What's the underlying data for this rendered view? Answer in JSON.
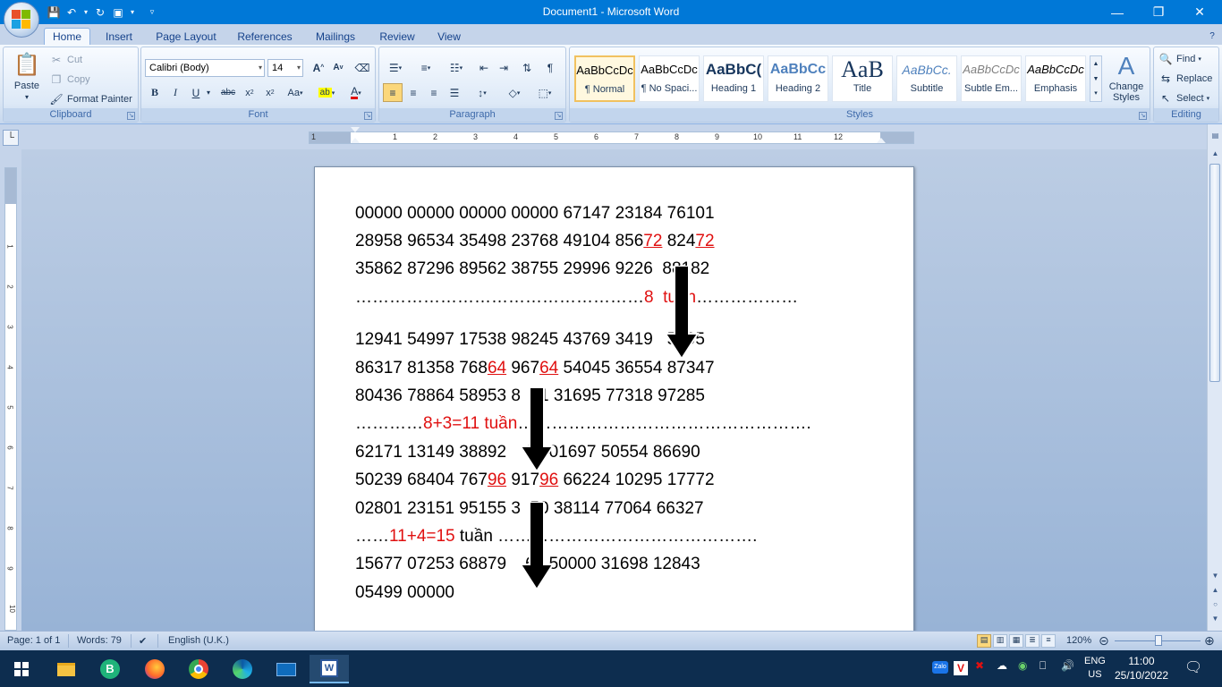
{
  "window": {
    "title": "Document1 - Microsoft Word"
  },
  "tabs": [
    "Home",
    "Insert",
    "Page Layout",
    "References",
    "Mailings",
    "Review",
    "View"
  ],
  "clipboard": {
    "paste": "Paste",
    "cut": "Cut",
    "copy": "Copy",
    "format_painter": "Format Painter",
    "label": "Clipboard"
  },
  "font": {
    "name": "Calibri (Body)",
    "size": "14",
    "label": "Font"
  },
  "paragraph": {
    "label": "Paragraph"
  },
  "styles": {
    "label": "Styles",
    "items": [
      {
        "sample": "AaBbCcDc",
        "name": "¶ Normal"
      },
      {
        "sample": "AaBbCcDc",
        "name": "¶ No Spaci..."
      },
      {
        "sample": "AaBbC(",
        "name": "Heading 1"
      },
      {
        "sample": "AaBbCc",
        "name": "Heading 2"
      },
      {
        "sample": "AaB",
        "name": "Title"
      },
      {
        "sample": "AaBbCc.",
        "name": "Subtitle"
      },
      {
        "sample": "AaBbCcDc",
        "name": "Subtle Em..."
      },
      {
        "sample": "AaBbCcDc",
        "name": "Emphasis"
      }
    ],
    "change_styles": "Change Styles"
  },
  "editing": {
    "find": "Find",
    "replace": "Replace",
    "select": "Select",
    "label": "Editing"
  },
  "ruler": {
    "numbers": [
      "1",
      "1",
      "2",
      "3",
      "4",
      "5",
      "6",
      "7",
      "8",
      "9",
      "10",
      "11",
      "12"
    ]
  },
  "document": {
    "lines": [
      {
        "parts": [
          {
            "t": "00000 00000 00000 00000 67147 23184 76101"
          }
        ]
      },
      {
        "parts": [
          {
            "t": "28958 96534 35498 23768 49104 856"
          },
          {
            "t": "72",
            "s": "redu"
          },
          {
            "t": " 824"
          },
          {
            "t": "72",
            "s": "redu"
          }
        ]
      },
      {
        "parts": [
          {
            "t": "35862 87296 89562 38755 29996 9226  88182"
          }
        ]
      },
      {
        "parts": [
          {
            "t": "……………………………………………"
          },
          {
            "t": "8  tuần",
            "s": "red"
          },
          {
            "t": "………………"
          }
        ]
      },
      {
        "parts": [
          {
            "t": "12941 54997 17538 98245 43769 3419   5295"
          }
        ]
      },
      {
        "parts": [
          {
            "t": "86317 81358 768"
          },
          {
            "t": "64",
            "s": "redu"
          },
          {
            "t": " 967"
          },
          {
            "t": "64",
            "s": "redu"
          },
          {
            "t": " 54045 36554 87347"
          }
        ]
      },
      {
        "parts": [
          {
            "t": "80436 78864 58953 8  91 31695 77318 97285"
          }
        ]
      },
      {
        "parts": [
          {
            "t": "…………"
          },
          {
            "t": "8+3=11 tuần",
            "s": "red"
          },
          {
            "t": "……………………………………………."
          }
        ]
      },
      {
        "parts": [
          {
            "t": "62171 13149 38892    39 01697 50554 86690"
          }
        ]
      },
      {
        "parts": [
          {
            "t": "50239 68404 767"
          },
          {
            "t": "96",
            "s": "redu"
          },
          {
            "t": " 917"
          },
          {
            "t": "96",
            "s": "redu"
          },
          {
            "t": " 66224 10295 17772"
          }
        ]
      },
      {
        "parts": [
          {
            "t": "02801 23151 95155 3  50 38114 77064 66327"
          }
        ]
      },
      {
        "parts": [
          {
            "t": "……"
          },
          {
            "t": "11+4=15",
            "s": "red"
          },
          {
            "t": " tuần ………………………………………."
          }
        ]
      },
      {
        "parts": [
          {
            "t": "15677 07253 68879    65 50000 31698 12843"
          }
        ]
      },
      {
        "parts": [
          {
            "t": "05499 00000"
          }
        ]
      }
    ]
  },
  "status": {
    "page": "Page: 1 of 1",
    "words": "Words: 79",
    "language": "English (U.K.)",
    "zoom": "120%"
  },
  "taskbar": {
    "lang1": "ENG",
    "lang2": "US",
    "time": "11:00",
    "date": "25/10/2022"
  }
}
